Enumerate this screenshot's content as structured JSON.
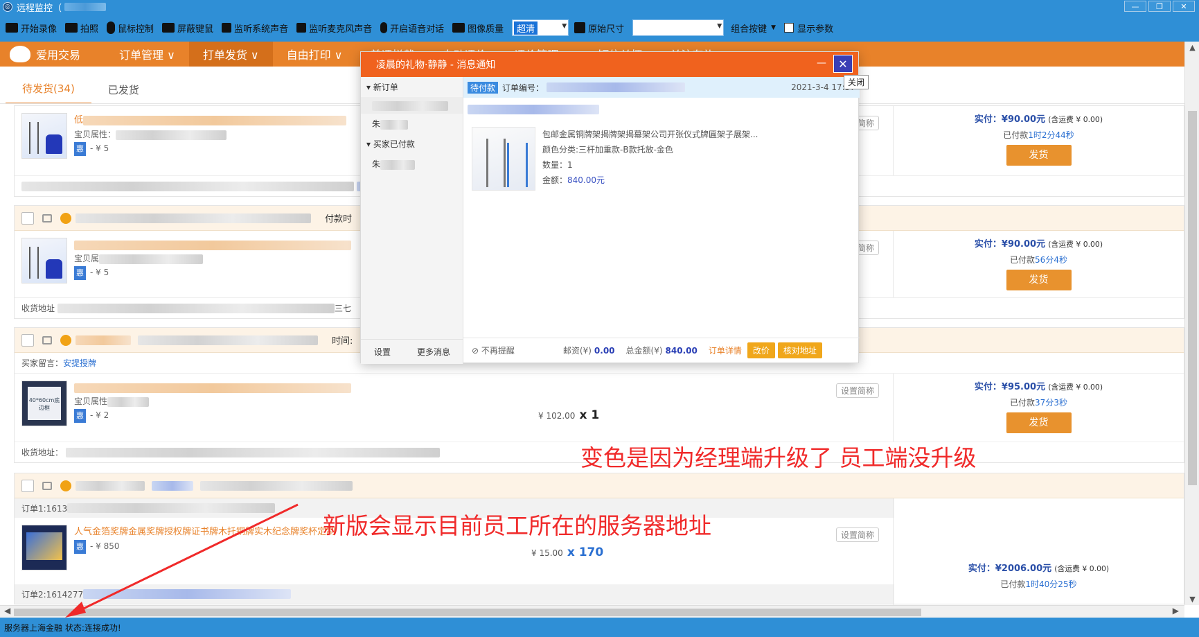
{
  "window": {
    "title": "远程监控（",
    "buttons": [
      "—",
      "❐",
      "✕"
    ]
  },
  "toolbar": {
    "items": [
      "开始录像",
      "拍照",
      "鼠标控制",
      "屏蔽键鼠",
      "监听系统声音",
      "监听麦克风声音",
      "开启语音对话",
      "图像质量"
    ],
    "quality_value": "超清",
    "size_label": "原始尺寸",
    "size_value": "",
    "combo_label": "组合按键",
    "show_params_label": "显示参数"
  },
  "nav": {
    "brand": "爱用交易",
    "items": [
      "订单管理 ∨",
      "打单发货 ∨",
      "自由打印 ∨",
      "差评拦截",
      "自动评价",
      "评价管理 ∨",
      "短信关怀",
      "关注有礼"
    ]
  },
  "tabs": [
    "待发货(34)",
    "已发货"
  ],
  "orders": [
    {
      "title_prefix": "低",
      "attr_label": "宝贝属性：",
      "hui": "惠",
      "price": "- ¥ 5",
      "set_short": "简称",
      "real": "实付：¥90.00元",
      "freight": "(含运费 ¥ 0.00)",
      "paid_prefix": "已付款",
      "paid_time": "1时2分44秒",
      "ship": "发货"
    },
    {
      "pay_time_label": "付款时",
      "attr_label": "宝贝属",
      "hui": "惠",
      "price": "- ¥ 5",
      "set_short": "简称",
      "real": "实付：¥90.00元",
      "freight": "(含运费 ¥ 0.00)",
      "paid_prefix": "已付款",
      "paid_time": "56分4秒",
      "ship": "发货",
      "addr_label": "收货地址",
      "addr_tail": "三七"
    },
    {
      "time_label": "时间:",
      "note_label": "买家留言：",
      "note_value": "安提授牌",
      "thumb_text": "40*60cm底边框",
      "attr_label": "宝贝属性",
      "hui": "惠",
      "price": "- ¥ 2",
      "unit_price": "¥ 102.00",
      "qty": "x 1",
      "set_short": "设置简称",
      "real": "实付：¥95.00元",
      "freight": "(含运费 ¥ 0.00)",
      "paid_prefix": "已付款",
      "paid_time": "37分3秒",
      "ship": "发货",
      "addr_label": "收货地址："
    },
    {
      "sub1": "订单1:1613",
      "title": "人气金箔奖牌金属奖牌授权牌证书牌木托铜牌实木纪念牌奖杯定制",
      "hui": "惠",
      "price": "- ¥ 850",
      "unit_price": "¥ 15.00",
      "qty": "x 170",
      "set_short": "设置简称",
      "sub2": "订单2:1614277",
      "real": "实付：¥2006.00元",
      "freight": "(含运费 ¥ 0.00)",
      "paid_prefix": "已付款",
      "paid_time": "1时40分25秒"
    }
  ],
  "popup": {
    "title": "凌晨的礼物·静静 - 消息通知",
    "min": "—",
    "close": "✕",
    "tooltip": "关闭",
    "side": {
      "group1": "▾ 新订单",
      "item1": "朱",
      "group2": "▾ 买家已付款",
      "item2": "朱",
      "settings": "设置",
      "more": "更多消息"
    },
    "order_badge": "待付款",
    "order_no_label": "订单编号：",
    "date": "2021-3-4 17:57",
    "product": "包邮金属铜牌架揭牌架揭幕架公司开张仪式牌匾架子展架...",
    "color": "颜色分类:三杆加重款-B款托放-金色",
    "qty": "数量：1",
    "amount_label": "金额：",
    "amount": "840.00元",
    "no_remind": "不再提醒",
    "post_label": "邮资(¥)",
    "post": "0.00",
    "total_label": "总金额(¥)",
    "total": "840.00",
    "detail": "订单详情",
    "change_price": "改价",
    "check_addr": "核对地址"
  },
  "statusbar": "服务器上海金融 状态:连接成功!",
  "annotations": {
    "a1": "变色是因为经理端升级了 员工端没升级",
    "a2": "新版会显示目前员工所在的服务器地址"
  },
  "colors": {
    "titlebar": "#2f8fd6",
    "nav": "#e8822a",
    "popup_head": "#f0621e",
    "annotation": "#f02a2a"
  }
}
